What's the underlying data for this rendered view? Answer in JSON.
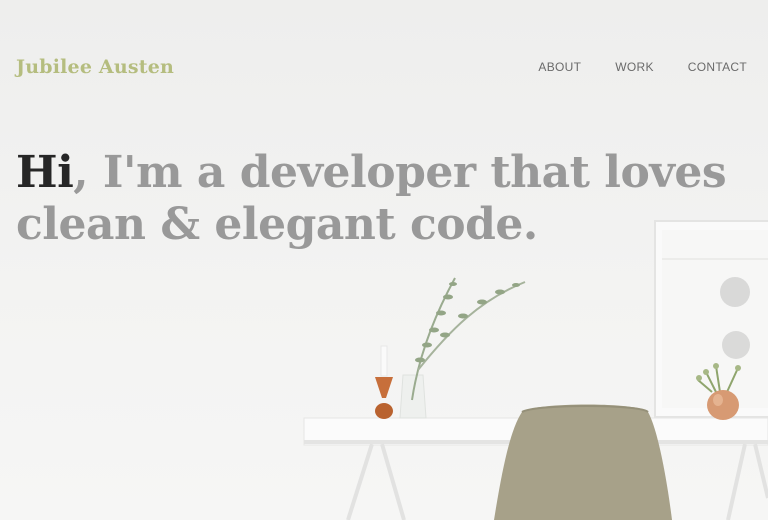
{
  "brand": {
    "name": "Jubilee Austen"
  },
  "nav": {
    "items": [
      "ABOUT",
      "WORK",
      "CONTACT"
    ]
  },
  "hero": {
    "greeting": "Hi",
    "line1_rest": ", I'm a developer that loves",
    "line2": "clean & elegant code."
  },
  "colors": {
    "brand": "#b5bd7f",
    "heading": "#999999",
    "greeting": "#262626",
    "nav": "#6a6a6a",
    "background": "#f0f0ef"
  },
  "icons": {
    "chair": "chair-illustration",
    "desk": "desk-illustration",
    "vase": "vase-plant-illustration",
    "candle": "candle-holder-illustration",
    "frame": "picture-frame-illustration",
    "pot": "copper-pot-illustration"
  }
}
